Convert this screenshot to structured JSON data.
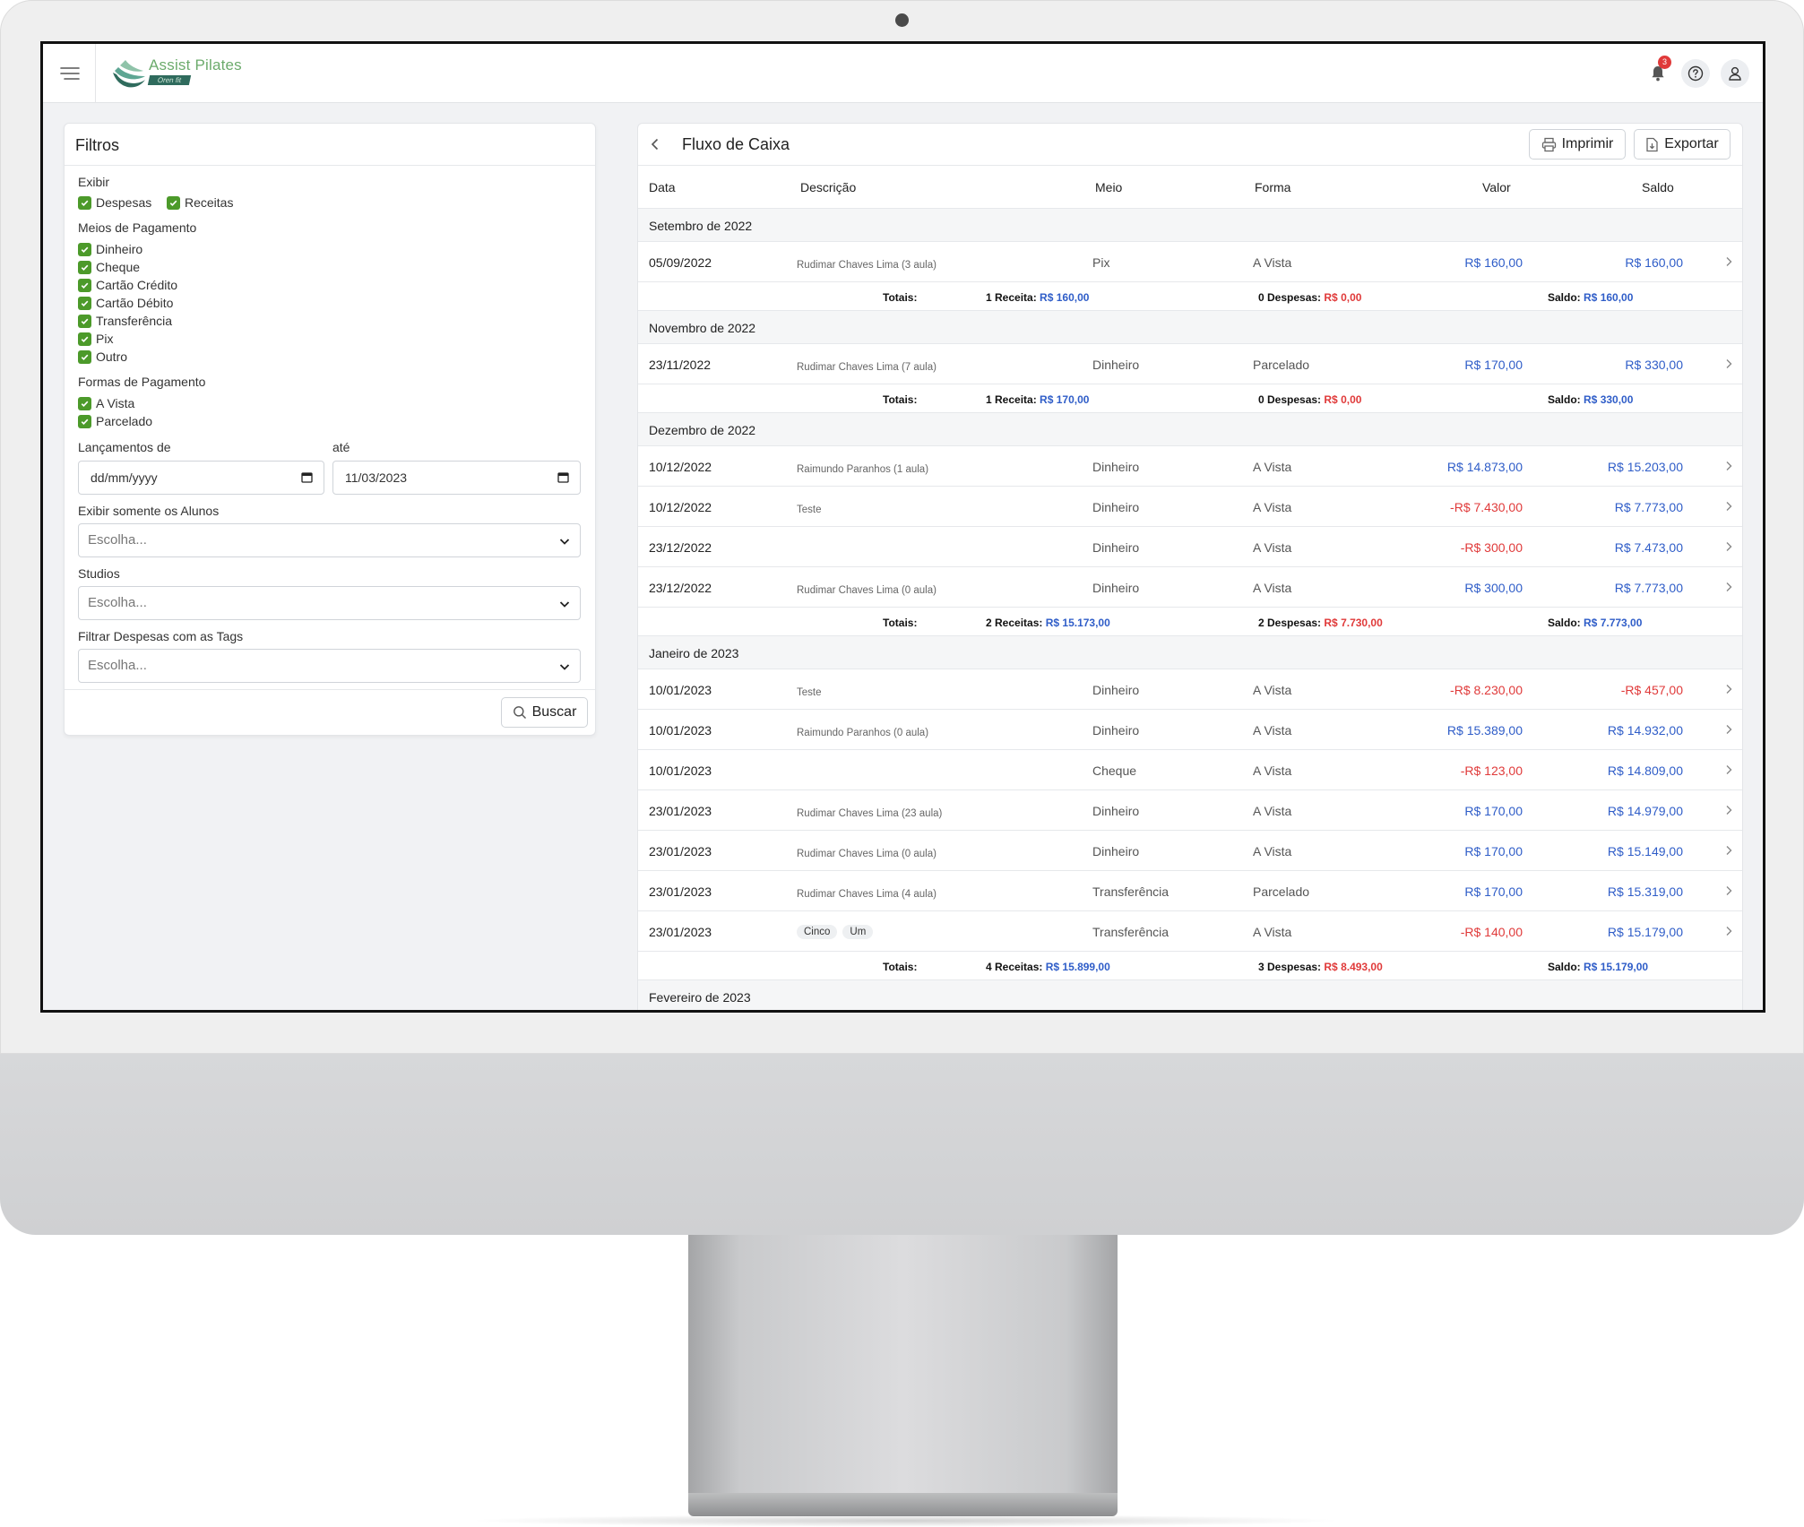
{
  "header": {
    "brand": "Assist Pilates",
    "brand_sub": "Oren fit",
    "notification_count": "3"
  },
  "filters": {
    "title": "Filtros",
    "exibir_label": "Exibir",
    "exibir": [
      "Despesas",
      "Receitas"
    ],
    "meios_label": "Meios de Pagamento",
    "meios": [
      "Dinheiro",
      "Cheque",
      "Cartão Crédito",
      "Cartão Débito",
      "Transferência",
      "Pix",
      "Outro"
    ],
    "formas_label": "Formas de Pagamento",
    "formas": [
      "A Vista",
      "Parcelado"
    ],
    "lancamentos_label": "Lançamentos de",
    "ate_label": "até",
    "date_from": "dd/mm/yyyy",
    "date_to": "11/03/2023",
    "alunos_label": "Exibir somente os Alunos",
    "alunos_value": "Escolha...",
    "studios_label": "Studios",
    "studios_value": "Escolha...",
    "tags_label": "Filtrar Despesas com as Tags",
    "tags_value": "Escolha...",
    "search_button": "Buscar"
  },
  "main": {
    "title": "Fluxo de Caixa",
    "print_button": "Imprimir",
    "export_button": "Exportar",
    "columns": [
      "Data",
      "Descrição",
      "Meio",
      "Forma",
      "Valor",
      "Saldo"
    ],
    "labels": {
      "totais": "Totais:",
      "saldo": "Saldo:"
    },
    "groups": [
      {
        "name": "Setembro de 2022",
        "rows": [
          {
            "date": "05/09/2022",
            "desc": "Rudimar Chaves Lima (3 aula)",
            "tags": [],
            "meio": "Pix",
            "forma": "A Vista",
            "valor": "R$ 160,00",
            "valor_neg": false,
            "saldo": "R$ 160,00",
            "saldo_neg": false
          }
        ],
        "totals": {
          "receitas_label": "1 Receita:",
          "receitas": "R$ 160,00",
          "despesas_label": "0 Despesas:",
          "despesas": "R$ 0,00",
          "saldo": "R$ 160,00"
        }
      },
      {
        "name": "Novembro de 2022",
        "rows": [
          {
            "date": "23/11/2022",
            "desc": "Rudimar Chaves Lima (7 aula)",
            "tags": [],
            "meio": "Dinheiro",
            "forma": "Parcelado",
            "valor": "R$ 170,00",
            "valor_neg": false,
            "saldo": "R$ 330,00",
            "saldo_neg": false
          }
        ],
        "totals": {
          "receitas_label": "1 Receita:",
          "receitas": "R$ 170,00",
          "despesas_label": "0 Despesas:",
          "despesas": "R$ 0,00",
          "saldo": "R$ 330,00"
        }
      },
      {
        "name": "Dezembro de 2022",
        "rows": [
          {
            "date": "10/12/2022",
            "desc": "Raimundo Paranhos (1 aula)",
            "tags": [],
            "meio": "Dinheiro",
            "forma": "A Vista",
            "valor": "R$ 14.873,00",
            "valor_neg": false,
            "saldo": "R$ 15.203,00",
            "saldo_neg": false
          },
          {
            "date": "10/12/2022",
            "desc": "Teste",
            "tags": [],
            "meio": "Dinheiro",
            "forma": "A Vista",
            "valor": "-R$ 7.430,00",
            "valor_neg": true,
            "saldo": "R$ 7.773,00",
            "saldo_neg": false
          },
          {
            "date": "23/12/2022",
            "desc": "",
            "tags": [],
            "meio": "Dinheiro",
            "forma": "A Vista",
            "valor": "-R$ 300,00",
            "valor_neg": true,
            "saldo": "R$ 7.473,00",
            "saldo_neg": false
          },
          {
            "date": "23/12/2022",
            "desc": "Rudimar Chaves Lima (0 aula)",
            "tags": [],
            "meio": "Dinheiro",
            "forma": "A Vista",
            "valor": "R$ 300,00",
            "valor_neg": false,
            "saldo": "R$ 7.773,00",
            "saldo_neg": false
          }
        ],
        "totals": {
          "receitas_label": "2 Receitas:",
          "receitas": "R$ 15.173,00",
          "despesas_label": "2 Despesas:",
          "despesas": "R$ 7.730,00",
          "saldo": "R$ 7.773,00"
        }
      },
      {
        "name": "Janeiro de 2023",
        "rows": [
          {
            "date": "10/01/2023",
            "desc": "Teste",
            "tags": [],
            "meio": "Dinheiro",
            "forma": "A Vista",
            "valor": "-R$ 8.230,00",
            "valor_neg": true,
            "saldo": "-R$ 457,00",
            "saldo_neg": true
          },
          {
            "date": "10/01/2023",
            "desc": "Raimundo Paranhos (0 aula)",
            "tags": [],
            "meio": "Dinheiro",
            "forma": "A Vista",
            "valor": "R$ 15.389,00",
            "valor_neg": false,
            "saldo": "R$ 14.932,00",
            "saldo_neg": false
          },
          {
            "date": "10/01/2023",
            "desc": "",
            "tags": [],
            "meio": "Cheque",
            "forma": "A Vista",
            "valor": "-R$ 123,00",
            "valor_neg": true,
            "saldo": "R$ 14.809,00",
            "saldo_neg": false
          },
          {
            "date": "23/01/2023",
            "desc": "Rudimar Chaves Lima (23 aula)",
            "tags": [],
            "meio": "Dinheiro",
            "forma": "A Vista",
            "valor": "R$ 170,00",
            "valor_neg": false,
            "saldo": "R$ 14.979,00",
            "saldo_neg": false
          },
          {
            "date": "23/01/2023",
            "desc": "Rudimar Chaves Lima (0 aula)",
            "tags": [],
            "meio": "Dinheiro",
            "forma": "A Vista",
            "valor": "R$ 170,00",
            "valor_neg": false,
            "saldo": "R$ 15.149,00",
            "saldo_neg": false
          },
          {
            "date": "23/01/2023",
            "desc": "Rudimar Chaves Lima (4 aula)",
            "tags": [],
            "meio": "Transferência",
            "forma": "Parcelado",
            "valor": "R$ 170,00",
            "valor_neg": false,
            "saldo": "R$ 15.319,00",
            "saldo_neg": false
          },
          {
            "date": "23/01/2023",
            "desc": "",
            "tags": [
              "Cinco",
              "Um"
            ],
            "meio": "Transferência",
            "forma": "A Vista",
            "valor": "-R$ 140,00",
            "valor_neg": true,
            "saldo": "R$ 15.179,00",
            "saldo_neg": false
          }
        ],
        "totals": {
          "receitas_label": "4 Receitas:",
          "receitas": "R$ 15.899,00",
          "despesas_label": "3 Despesas:",
          "despesas": "R$ 8.493,00",
          "saldo": "R$ 15.179,00"
        }
      },
      {
        "name": "Fevereiro de 2023",
        "rows": [],
        "totals": null
      }
    ]
  },
  "colors": {
    "accent": "#4c9a2a",
    "positive": "#2f5dc8",
    "negative": "#e03a3a"
  }
}
